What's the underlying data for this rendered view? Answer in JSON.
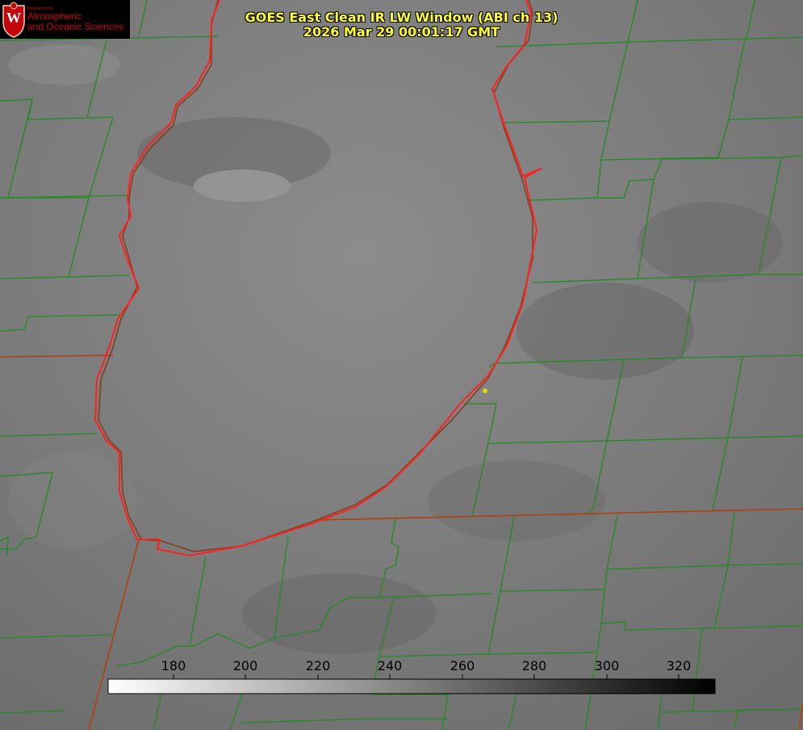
{
  "header": {
    "title_line1": "GOES East Clean IR LW Window (ABI ch 13)",
    "title_line2": "2026 Mar 29 00:01:17 GMT"
  },
  "logo": {
    "line1": "Department of",
    "line2": "Atmospheric",
    "line3": "and Oceanic Sciences",
    "emblem_letter": "W"
  },
  "colorbar": {
    "ticks": [
      "180",
      "200",
      "220",
      "240",
      "260",
      "280",
      "300",
      "320"
    ]
  },
  "colors": {
    "coastline": "#ff2020",
    "county_borders": "#1e8c1e",
    "state_borders": "#b04010",
    "marker": "#e6d200",
    "title_text": "#ffff33",
    "logo_red": "#c5050c"
  }
}
